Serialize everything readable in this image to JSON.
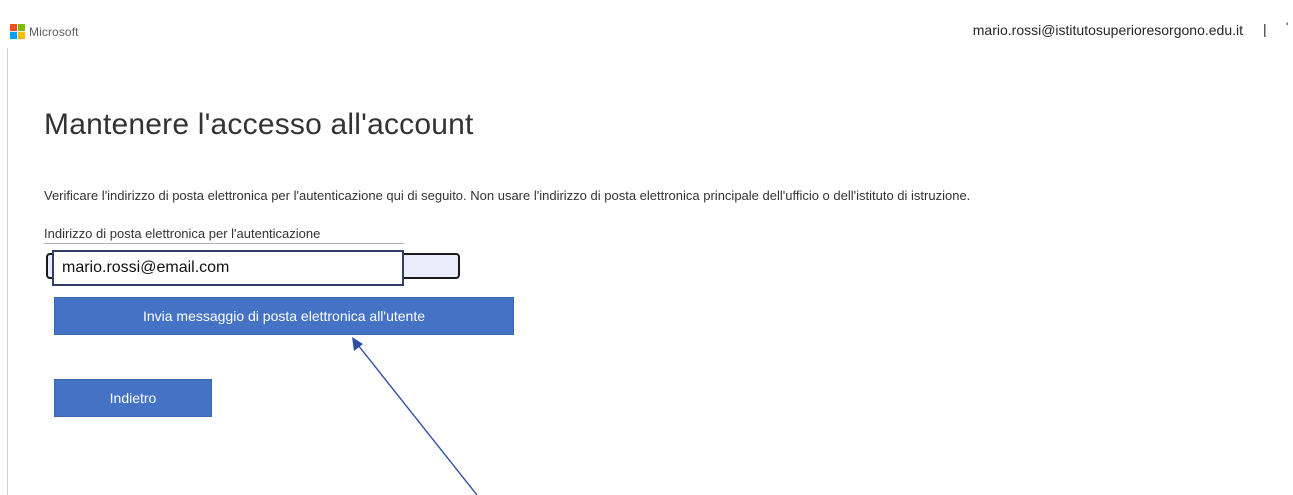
{
  "header": {
    "brand": "Microsoft",
    "user_email": "mario.rossi@istitutosuperioresorgono.edu.it",
    "separator": "|",
    "edge_glyph": "'"
  },
  "main": {
    "title": "Mantenere l'accesso all'account",
    "description": "Verificare l'indirizzo di posta elettronica per l'autenticazione qui di seguito. Non usare l'indirizzo di posta elettronica principale dell'ufficio o dell'istituto di istruzione.",
    "field_label": "Indirizzo di posta elettronica per l'autenticazione",
    "email_value": "mario.rossi@email.com",
    "send_button": "Invia messaggio di posta elettronica all'utente",
    "back_button": "Indietro"
  },
  "colors": {
    "button_blue": "#4472c4",
    "logo_red": "#f25022",
    "logo_green": "#7fba00",
    "logo_blue": "#00a4ef",
    "logo_yellow": "#ffb900",
    "annotation_arrow": "#2f4fa3"
  },
  "icons": {
    "logo": "microsoft-logo-icon",
    "arrow": "annotation-arrow-icon"
  }
}
